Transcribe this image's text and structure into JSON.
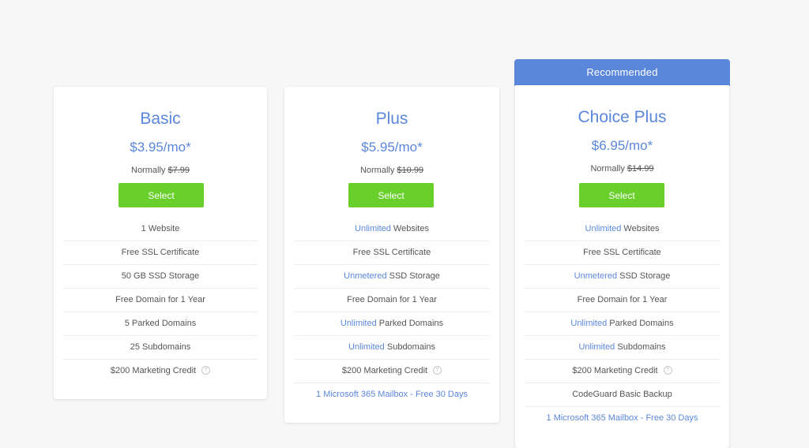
{
  "ribbon": {
    "label": "Recommended"
  },
  "common": {
    "normally_label": "Normally",
    "select_label": "Select",
    "help_glyph": "?"
  },
  "colors": {
    "accent": "#5b87da",
    "button": "#69cf2b",
    "ribbon": "#5b87da",
    "text": "#555555"
  },
  "plans": [
    {
      "name": "Basic",
      "price": "$3.95/mo*",
      "normal_price": "$7.99",
      "features": [
        {
          "hl": "",
          "text": "1 Website"
        },
        {
          "hl": "",
          "text": "Free SSL Certificate"
        },
        {
          "hl": "",
          "text": "50 GB SSD Storage"
        },
        {
          "hl": "",
          "text": "Free Domain for 1 Year"
        },
        {
          "hl": "",
          "text": "5 Parked Domains"
        },
        {
          "hl": "",
          "text": "25 Subdomains"
        },
        {
          "hl": "",
          "text": "$200 Marketing Credit",
          "help": true
        }
      ]
    },
    {
      "name": "Plus",
      "price": "$5.95/mo*",
      "normal_price": "$10.99",
      "features": [
        {
          "hl": "Unlimited",
          "text": " Websites"
        },
        {
          "hl": "",
          "text": "Free SSL Certificate"
        },
        {
          "hl": "Unmetered",
          "text": " SSD Storage"
        },
        {
          "hl": "",
          "text": "Free Domain for 1 Year"
        },
        {
          "hl": "Unlimited",
          "text": " Parked Domains"
        },
        {
          "hl": "Unlimited",
          "text": " Subdomains"
        },
        {
          "hl": "",
          "text": "$200 Marketing Credit",
          "help": true
        },
        {
          "hl": "",
          "text": "1 Microsoft 365 Mailbox - Free 30 Days",
          "link": true
        }
      ]
    },
    {
      "name": "Choice Plus",
      "price": "$6.95/mo*",
      "normal_price": "$14.99",
      "features": [
        {
          "hl": "Unlimited",
          "text": " Websites"
        },
        {
          "hl": "",
          "text": "Free SSL Certificate"
        },
        {
          "hl": "Unmetered",
          "text": " SSD Storage"
        },
        {
          "hl": "",
          "text": "Free Domain for 1 Year"
        },
        {
          "hl": "Unlimited",
          "text": " Parked Domains"
        },
        {
          "hl": "Unlimited",
          "text": " Subdomains"
        },
        {
          "hl": "",
          "text": "$200 Marketing Credit",
          "help": true
        },
        {
          "hl": "",
          "text": "CodeGuard Basic Backup"
        },
        {
          "hl": "",
          "text": "1 Microsoft 365 Mailbox - Free 30 Days",
          "link": true
        }
      ]
    }
  ]
}
